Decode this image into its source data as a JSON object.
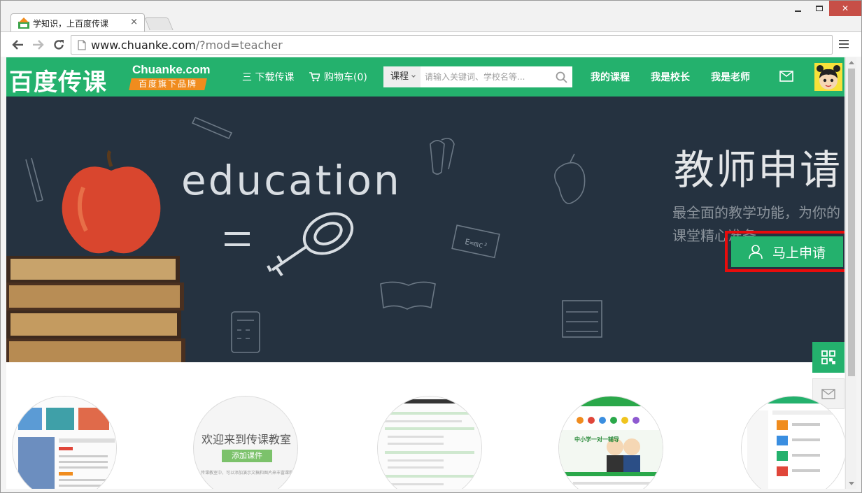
{
  "browser": {
    "tab_title": "学知识，上百度传课",
    "tab_close": "×",
    "url_host": "www.chuanke.com",
    "url_path": "/?mod=teacher",
    "win_close": "✕"
  },
  "header": {
    "logo_cn": "百度传课",
    "logo_en": "Chuanke.com",
    "logo_tag": "百度旗下品牌",
    "nav_download": "三 下载传课",
    "nav_cart": "购物车(0)",
    "search_scope": "课程",
    "search_placeholder": "请输入关键词、学校名等...",
    "nav_mycourse": "我的课程",
    "nav_principal": "我是校长",
    "nav_teacher": "我是老师"
  },
  "banner": {
    "art_text": "education",
    "title": "教师申请",
    "subtitle": "最全面的教学功能，为你的课堂精心准备。",
    "apply_button": "马上申请"
  },
  "features": {
    "c2_title": "欢迎来到传课教室",
    "c2_button": "添加课件",
    "c2_note": "传课教室中，可以添加演示文稿和图片来丰富课程内容",
    "c4_heading": "中小学一对一辅导"
  },
  "colors": {
    "brand_green": "#24b16d",
    "banner_bg": "#253240",
    "highlight_red": "#e80c0c",
    "tag_orange": "#f08c1e"
  }
}
